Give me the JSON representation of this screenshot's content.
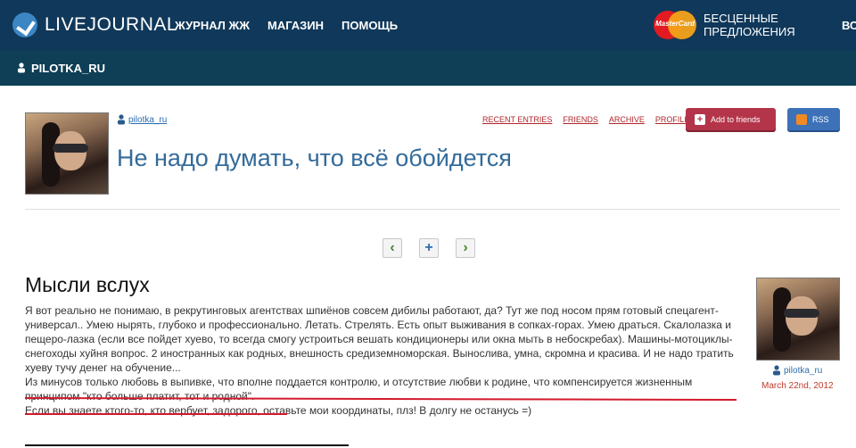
{
  "header": {
    "logo_text": "LIVEJOURNAL",
    "nav": [
      "ЖУРНАЛ ЖЖ",
      "МАГАЗИН",
      "ПОМОЩЬ"
    ],
    "mastercard_label": "MasterCard",
    "promo_line1": "БЕСЦЕННЫЕ",
    "promo_line2": "ПРЕДЛОЖЕНИЯ",
    "right_cut": "ВС"
  },
  "userbar": {
    "username": "PILOTKA_RU"
  },
  "journal": {
    "username": "pilotka_ru",
    "title": "Не надо думать, что всё обойдется",
    "nav": [
      "RECENT ENTRIES",
      "FRIENDS",
      "ARCHIVE",
      "PROFILE"
    ],
    "add_to_friends": "Add to friends",
    "rss": "RSS"
  },
  "pager": {
    "prev": "‹",
    "add": "+",
    "next": "›"
  },
  "post": {
    "title": "Мысли вслух",
    "body_1": "Я вот реально не понимаю, в рекрутинговых агентствах шпиёнов совсем дибилы работают, да? Тут же под носом прям готовый спецагент-универсал.. Умею нырять, глубоко и профессионально. Летать. Стрелять. Есть опыт выживания в сопках-горах. Умею драться. Скалолазка и пещеро-лазка (если все пойдет хуево, то всегда смогу устроиться вешать кондиционеры или окна мыть в небоскребах). Машины-мотоциклы-снегоходы хуйня вопрос. 2 иностранных как родных, внешность средиземноморская.  Вынослива, умна, скромна и красива. И не надо тратить хуеву тучу денег на обучение...",
    "body_2": "Из минусов только любовь в выпивке, что вполне поддается контролю, и отсутствие любви к родине, что компенсируется жизненным принципом \"кто больше платит, тот и родной\".",
    "body_3": "Если вы знаете ктого-то, кто вербует, задорого, оставьте мои координаты, плз! В долгу не останусь =)",
    "author": "pilotka_ru",
    "date": "March 22nd, 2012"
  },
  "colors": {
    "header_bg": "#10385a",
    "userbar_bg": "#0f3f56",
    "title_blue": "#336b9a",
    "link_red": "#b0252a",
    "underline_red": "#d31a2d"
  }
}
